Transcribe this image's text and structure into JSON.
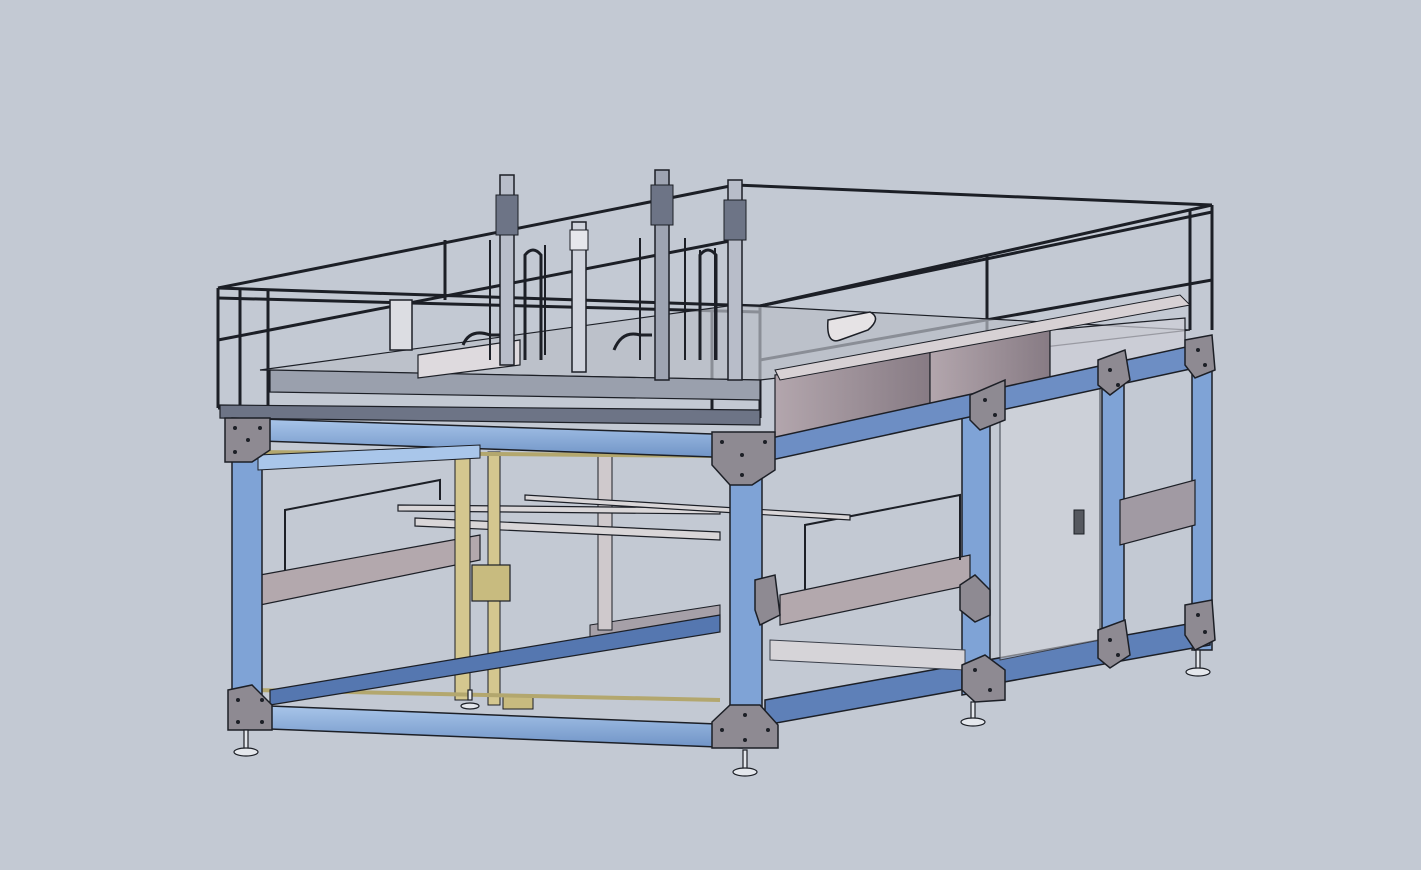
{
  "viewport": {
    "background": "#c3c9d3"
  },
  "model": {
    "description_icon": "cad-assembly-icon",
    "colors": {
      "frame_blue": "#8fb3e0",
      "frame_blue_dark": "#3d5d8c",
      "gusset": "#8e8a92",
      "outline": "#1c1f26",
      "rail": "#6d7486",
      "panel_mauve": "#9e9098",
      "panel_light": "#d9d3d6",
      "beige": "#b7ad86",
      "olive": "#c2b478",
      "foot": "#d9dde3"
    }
  }
}
